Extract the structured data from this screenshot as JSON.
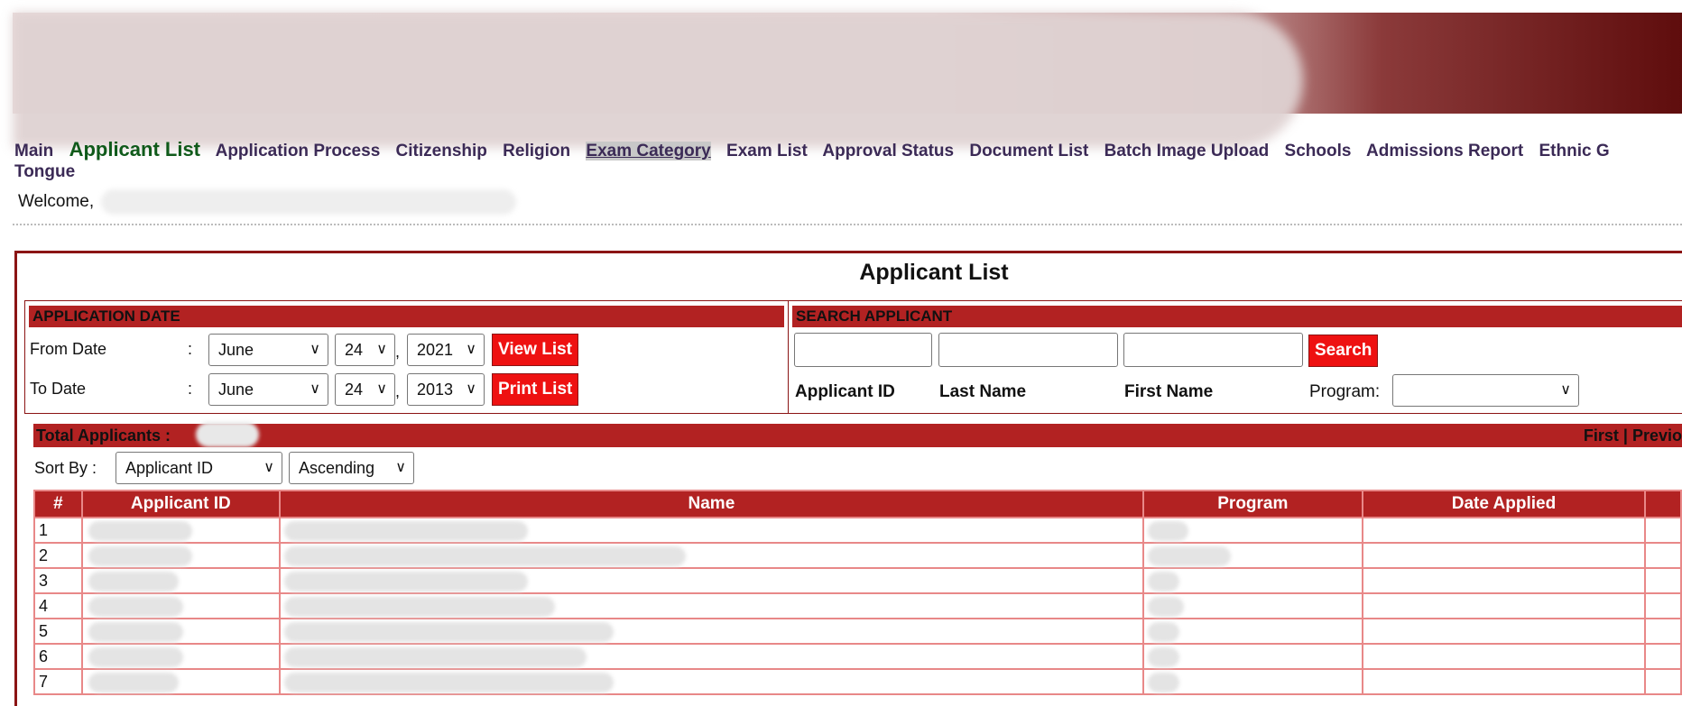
{
  "menu": {
    "items": [
      {
        "label": "Main"
      },
      {
        "label": "Applicant List"
      },
      {
        "label": "Application Process"
      },
      {
        "label": "Citizenship"
      },
      {
        "label": "Religion"
      },
      {
        "label": "Exam Category"
      },
      {
        "label": "Exam List"
      },
      {
        "label": "Approval Status"
      },
      {
        "label": "Document List"
      },
      {
        "label": "Batch Image Upload"
      },
      {
        "label": "Schools"
      },
      {
        "label": "Admissions Report"
      },
      {
        "label": "Ethnic G"
      }
    ],
    "wrap_label": "Tongue"
  },
  "welcome": "Welcome,",
  "page_title": "Applicant List",
  "application_date": {
    "heading": "APPLICATION DATE",
    "from_label": "From Date",
    "to_label": "To Date",
    "colon": ":",
    "from": {
      "month": "June",
      "day": "24",
      "year": "2021"
    },
    "to": {
      "month": "June",
      "day": "24",
      "year": "2013"
    },
    "comma": ",",
    "view_list": "View List",
    "print_list": "Print List"
  },
  "search_applicant": {
    "heading": "SEARCH APPLICANT",
    "search_button": "Search",
    "applicant_id_label": "Applicant ID",
    "last_name_label": "Last Name",
    "first_name_label": "First Name",
    "program_label": "Program:",
    "program_value": ""
  },
  "totals": {
    "label": "Total Applicants :",
    "pager": "First | Previo"
  },
  "sort": {
    "label": "Sort By :",
    "field": "Applicant ID",
    "order": "Ascending"
  },
  "table": {
    "columns": [
      "#",
      "Applicant ID",
      "Name",
      "Program",
      "Date Applied"
    ],
    "rows": [
      "1",
      "2",
      "3",
      "4",
      "5",
      "6",
      "7"
    ]
  },
  "colors": {
    "accent": "#b22222",
    "button_red": "#ee1111",
    "menu_text": "#3b2a56",
    "menu_active": "#0f5a1a",
    "table_border": "#e88888"
  }
}
